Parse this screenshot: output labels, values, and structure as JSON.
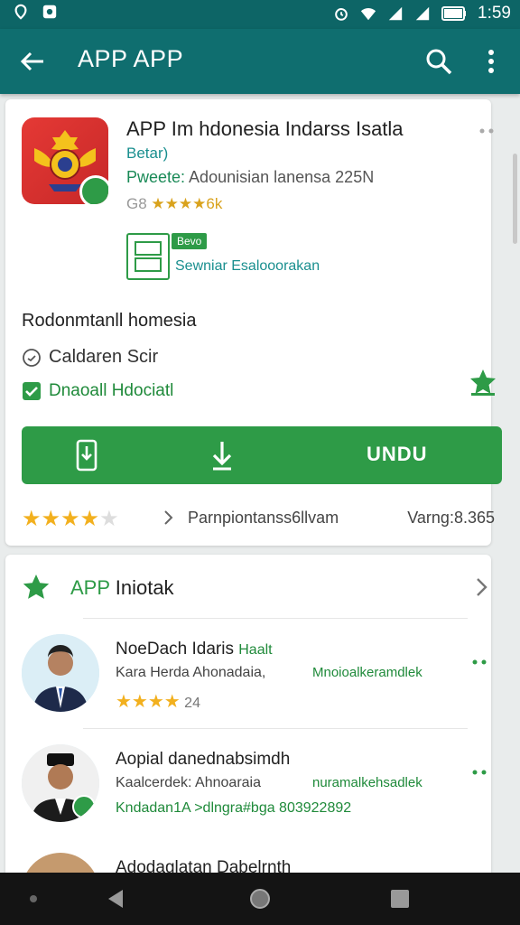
{
  "status_bar": {
    "time": "1:59"
  },
  "app_bar": {
    "title": "APP APP"
  },
  "app": {
    "name": "APP Im hdonesia Indarss Isatla",
    "developer": "Betar)",
    "meta_prefix": "Pweete: ",
    "meta_rest": "Adounisian lanensa 225N",
    "rating_prefix": "G8 ",
    "rating_stars": "★★★★",
    "rating_suffix": "6k",
    "pegi_chip": "Bevo",
    "pegi_label": "Sewniar Esalooorakan",
    "description": "Rodonmtanll homesia",
    "calendar_label": "Caldaren Scir",
    "verified_label": "Dnaoall Hdociatl",
    "install_label": "UNDU",
    "rating_value": 4,
    "review_label": "Parnpiontanss6llvam",
    "version_label": "Varng:8.365"
  },
  "section": {
    "title_accent": "APP",
    "title_rest": " Iniotak"
  },
  "people": [
    {
      "name": "NoeDach Idaris",
      "tag": "Haalt",
      "subtitle": "Kara Herda Ahonadaia,",
      "role": "Mnoioalkeramdlek",
      "stars": "★★★★",
      "count": "24",
      "avatar_color": "#dbeef6"
    },
    {
      "name": "Aopial danednabsimdh",
      "subtitle": "Kaalcerdek: Ahnoaraia",
      "role": "nuramalkehsadlek",
      "line3": "Kndadan1A >dlngra#bga 803922892",
      "avatar_color": "#f0f0f0"
    },
    {
      "name": "Adodaglatan Dabelrnth"
    }
  ],
  "colors": {
    "teal": "#0f6e6f",
    "green": "#2e9b47",
    "star": "#f2b01e"
  }
}
